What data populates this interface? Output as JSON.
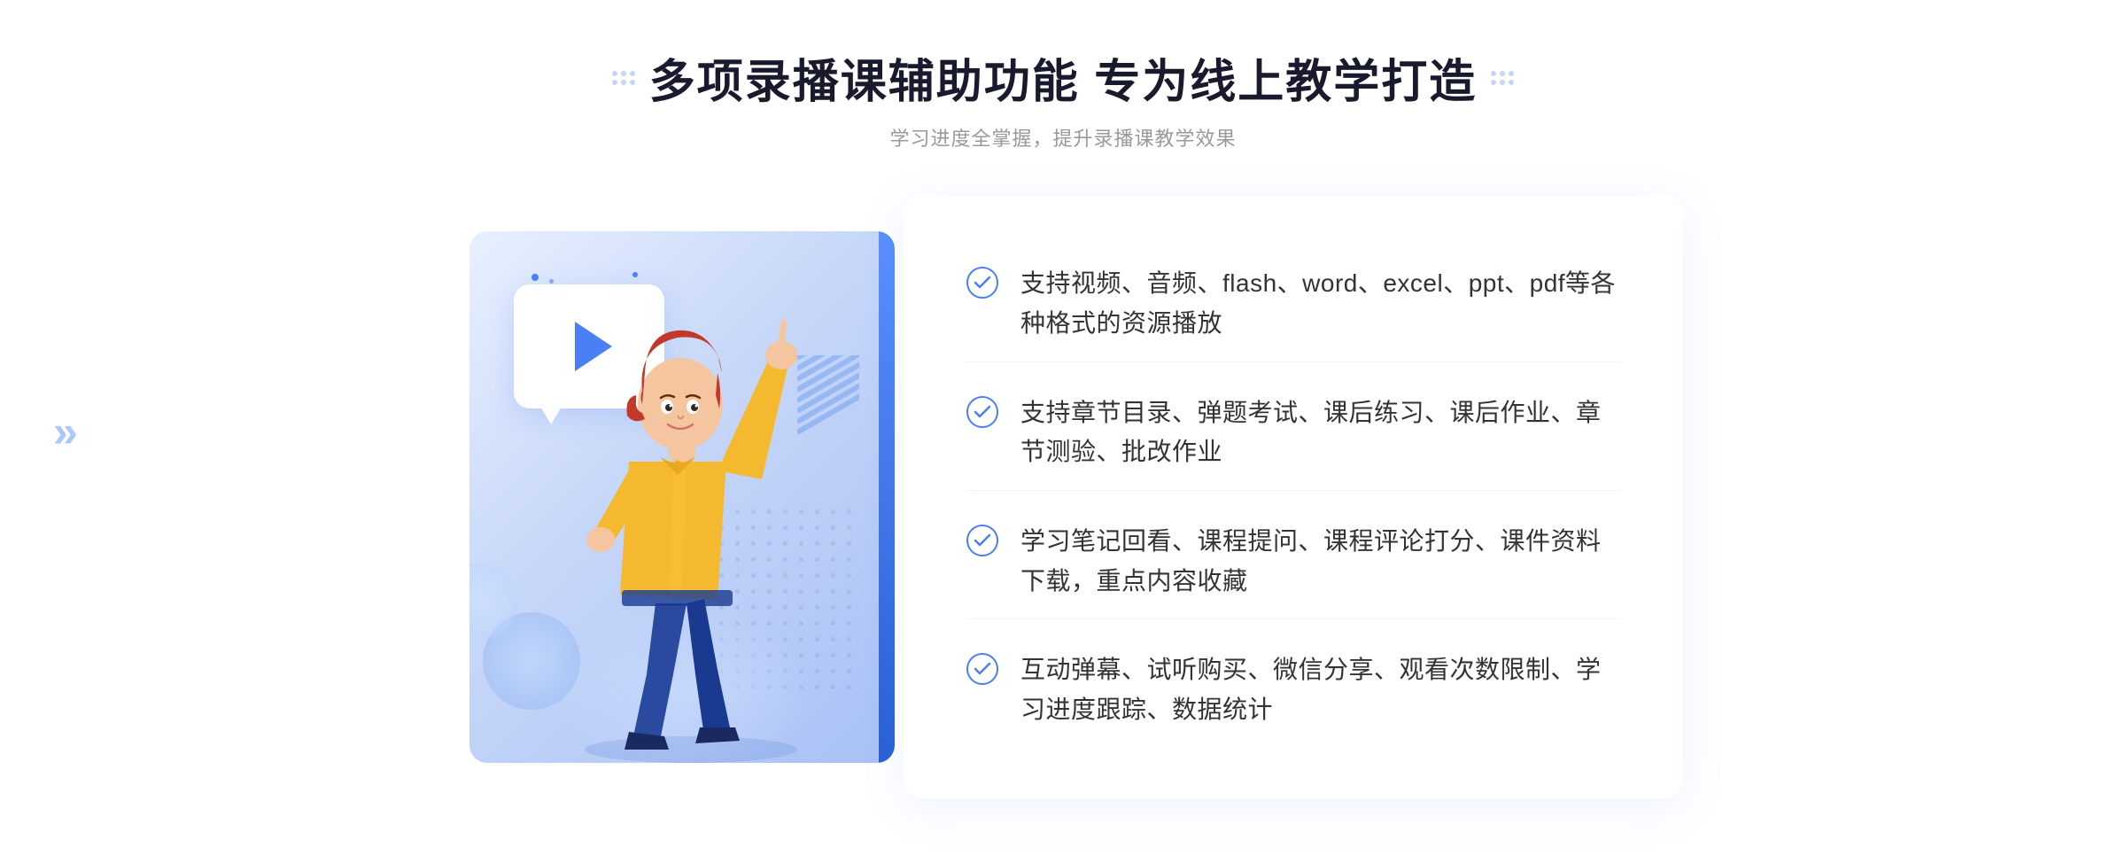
{
  "header": {
    "title": "多项录播课辅助功能 专为线上教学打造",
    "subtitle": "学习进度全掌握，提升录播课教学效果",
    "left_dots_label": "decorative-dots-left",
    "right_dots_label": "decorative-dots-right"
  },
  "features": [
    {
      "id": 1,
      "text": "支持视频、音频、flash、word、excel、ppt、pdf等各种格式的资源播放"
    },
    {
      "id": 2,
      "text": "支持章节目录、弹题考试、课后练习、课后作业、章节测验、批改作业"
    },
    {
      "id": 3,
      "text": "学习笔记回看、课程提问、课程评论打分、课件资料下载，重点内容收藏"
    },
    {
      "id": 4,
      "text": "互动弹幕、试听购买、微信分享、观看次数限制、学习进度跟踪、数据统计"
    }
  ],
  "colors": {
    "primary_blue": "#4a7ff5",
    "light_blue": "#aac8ff",
    "bg_gradient_start": "#e8f0ff",
    "bg_gradient_end": "#a8c0f5",
    "text_dark": "#333333",
    "text_gray": "#999999",
    "title_color": "#1a1a2e"
  },
  "illustration": {
    "play_button_alt": "video play button"
  },
  "nav_arrows": {
    "left": "«",
    "right": "»"
  }
}
